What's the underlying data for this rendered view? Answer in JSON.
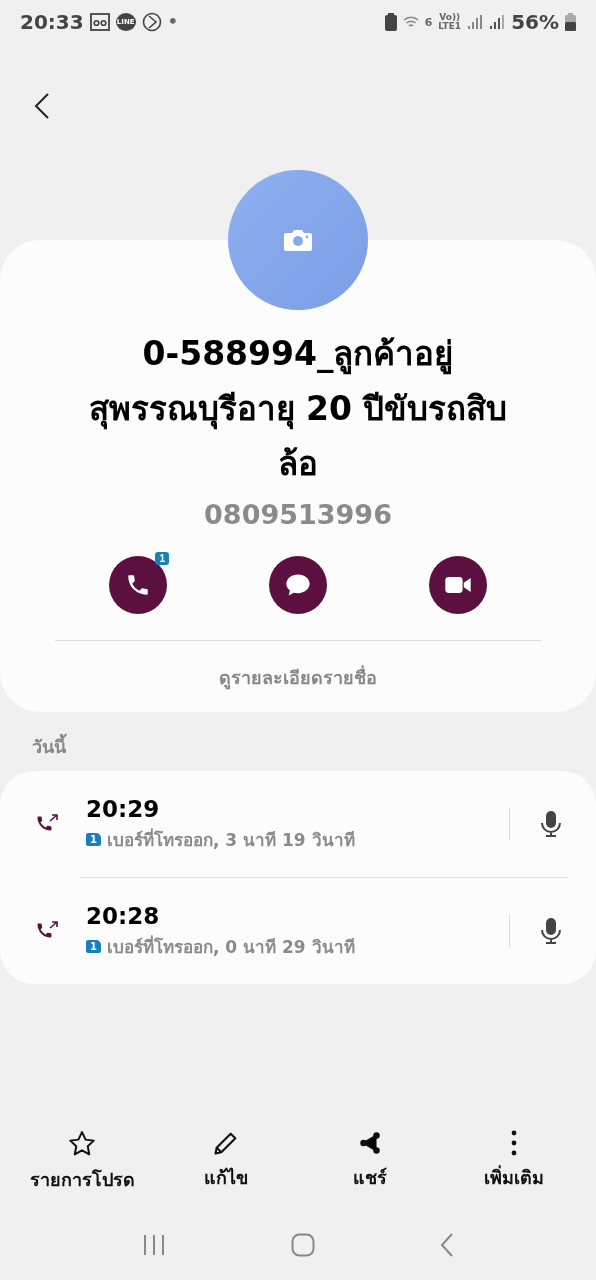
{
  "status_bar": {
    "time": "20:33",
    "notification_dot": "•",
    "line_logo": "LINE",
    "wifi_number": "6",
    "volte": "Vo))",
    "lte": "LTE1",
    "battery": "56%"
  },
  "contact": {
    "name": "0-588994_ลูกค้าอยู่สุพรรณบุรีอายุ 20 ปีขับรถสิบล้อ",
    "phone": "0809513996",
    "actions": [
      {
        "kind": "call",
        "badge": "1"
      },
      {
        "kind": "message"
      },
      {
        "kind": "video"
      }
    ],
    "details_link": "ดูรายละเอียดรายชื่อ"
  },
  "history": {
    "heading": "วันนี้",
    "calls": [
      {
        "time": "20:29",
        "sim": "1",
        "detail": "เบอร์ที่โทรออก, 3 นาที 19 วินาที"
      },
      {
        "time": "20:28",
        "sim": "1",
        "detail": "เบอร์ที่โทรออก, 0 นาที 29 วินาที"
      }
    ]
  },
  "bottom_actions": [
    {
      "kind": "favorite",
      "label": "รายการโปรด"
    },
    {
      "kind": "edit",
      "label": "แก้ไข"
    },
    {
      "kind": "share",
      "label": "แชร์"
    },
    {
      "kind": "more",
      "label": "เพิ่มเติม"
    }
  ]
}
